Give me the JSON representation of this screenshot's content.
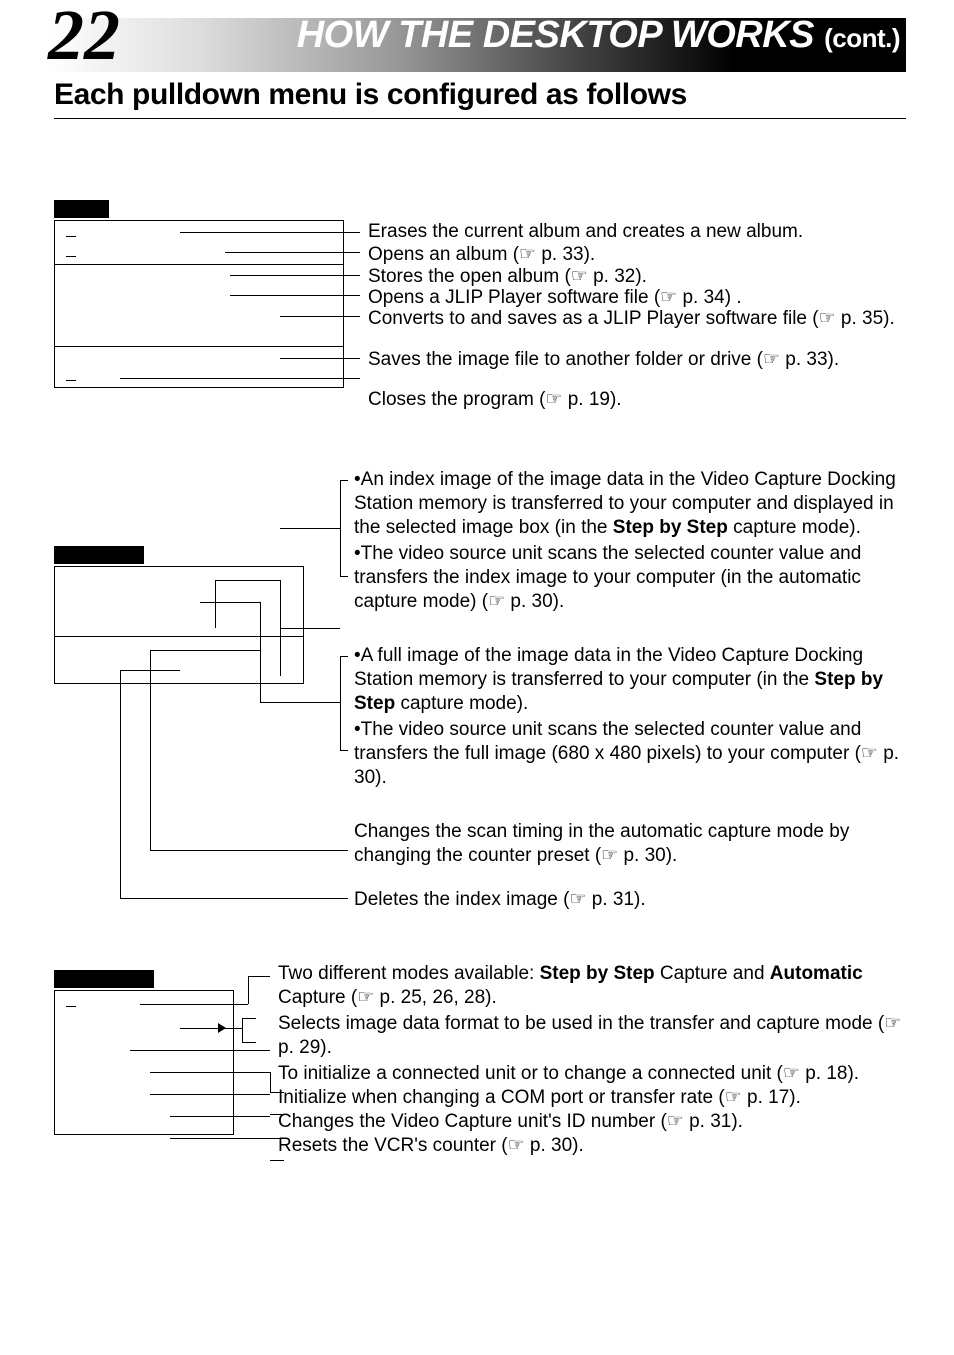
{
  "page_number": "22",
  "header": {
    "title": "HOW THE DESKTOP WORKS",
    "cont": "(cont.)"
  },
  "subhead": "Each pulldown menu is configured as follows",
  "file_menu": {
    "d0": "Erases the current album and creates a new album.",
    "d1": "Opens an album (☞ p. 33).",
    "d2": "Stores the open album (☞ p. 32).",
    "d3": "Opens a JLIP Player software file (☞ p. 34) .",
    "d4": "Converts to and saves as a JLIP Player software file (☞ p. 35).",
    "d5": "Saves the image file to another folder or drive (☞ p. 33).",
    "d6": "Closes the program (☞ p. 19)."
  },
  "capture_menu": {
    "b1a_pre": "•An index image of the image data in the Video Capture Docking Station memory is transferred to your computer and displayed in the selected image box (in the ",
    "b1a_bold": "Step by Step",
    "b1a_post": " capture mode).",
    "b1b": "•The video source unit scans the selected counter value and transfers the index image to your computer (in the automatic capture mode) (☞ p. 30).",
    "b2a_pre": "•A full image of the image data in the Video Capture Docking Station memory is transferred to your computer (in the ",
    "b2a_bold": "Step by Step",
    "b2a_post": " capture mode).",
    "b2b": "•The video source unit scans the selected counter value and transfers the full image (680 x 480 pixels) to your computer (☞ p. 30).",
    "d3": "Changes the scan timing in the automatic capture mode by changing the counter preset (☞ p. 30).",
    "d4": "Deletes the index image (☞ p. 31)."
  },
  "setup_menu": {
    "d1_pre": "Two different modes available: ",
    "d1_b1": "Step by Step",
    "d1_mid": " Capture and ",
    "d1_b2": "Automatic",
    "d1_post": " Capture (☞ p. 25, 26, 28).",
    "d2": "Selects image data format to be used in the transfer and capture mode (☞ p. 29).",
    "d3": "To initialize a connected unit or to change a connected unit (☞ p. 18).",
    "d4": "Initialize when changing a COM port or transfer rate (☞ p. 17).",
    "d5": "Changes the Video Capture unit's ID number (☞ p. 31).",
    "d6": "Resets the VCR's counter (☞ p. 30)."
  }
}
